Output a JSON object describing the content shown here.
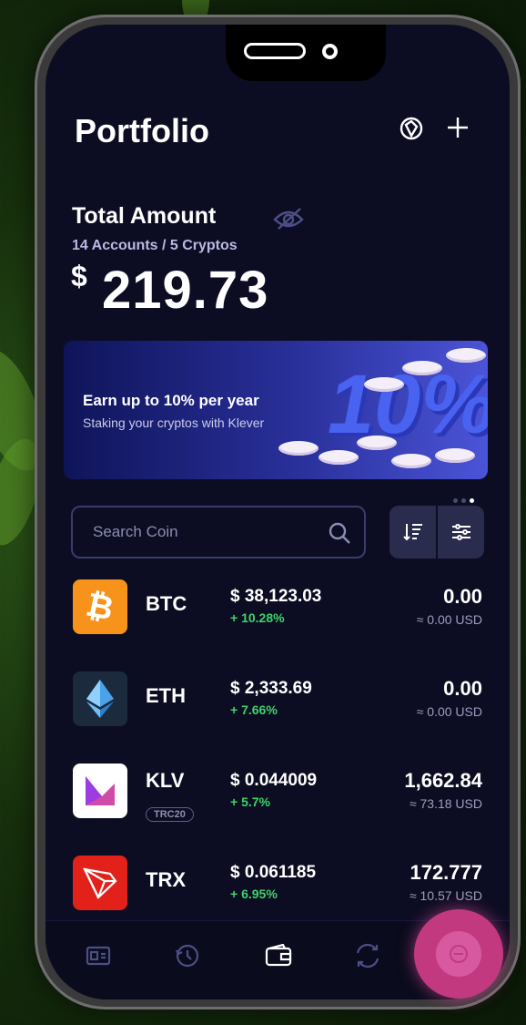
{
  "header": {
    "title": "Portfolio",
    "icons": [
      "network-icon",
      "plus-icon"
    ]
  },
  "total": {
    "label": "Total Amount",
    "subtitle": "14 Accounts / 5 Cryptos",
    "currency": "$",
    "amount": "219.73"
  },
  "banner": {
    "title": "Earn up to 10% per year",
    "subtitle": "Staking your cryptos with Klever",
    "graphic_text": "10%",
    "page_count": 3,
    "active_page": 3
  },
  "search": {
    "placeholder": "Search Coin"
  },
  "tools": [
    "sort-icon",
    "filter-icon"
  ],
  "coins": [
    {
      "symbol": "BTC",
      "price": "$ 38,123.03",
      "change": "+ 10.28%",
      "balance": "0.00",
      "usd": "≈ 0.00 USD",
      "badge": "",
      "color": "#f7931a",
      "icon": "bitcoin-icon"
    },
    {
      "symbol": "ETH",
      "price": "$ 2,333.69",
      "change": "+ 7.66%",
      "balance": "0.00",
      "usd": "≈ 0.00 USD",
      "badge": "",
      "color": "#1c2a3d",
      "icon": "ethereum-icon"
    },
    {
      "symbol": "KLV",
      "price": "$ 0.044009",
      "change": "+ 5.7%",
      "balance": "1,662.84",
      "usd": "≈ 73.18 USD",
      "badge": "TRC20",
      "color": "#ffffff",
      "icon": "klever-icon"
    },
    {
      "symbol": "TRX",
      "price": "$ 0.061185",
      "change": "+ 6.95%",
      "balance": "172.777",
      "usd": "≈ 10.57 USD",
      "badge": "",
      "color": "#e3211b",
      "icon": "tron-icon"
    }
  ],
  "tabbar": [
    "id-card-icon",
    "history-icon",
    "wallet-icon",
    "exchange-icon",
    "menu-icon"
  ],
  "colors": {
    "screen_bg": "#0c0d22",
    "accent_positive": "#3ed36a",
    "fab": "#c2397f"
  }
}
